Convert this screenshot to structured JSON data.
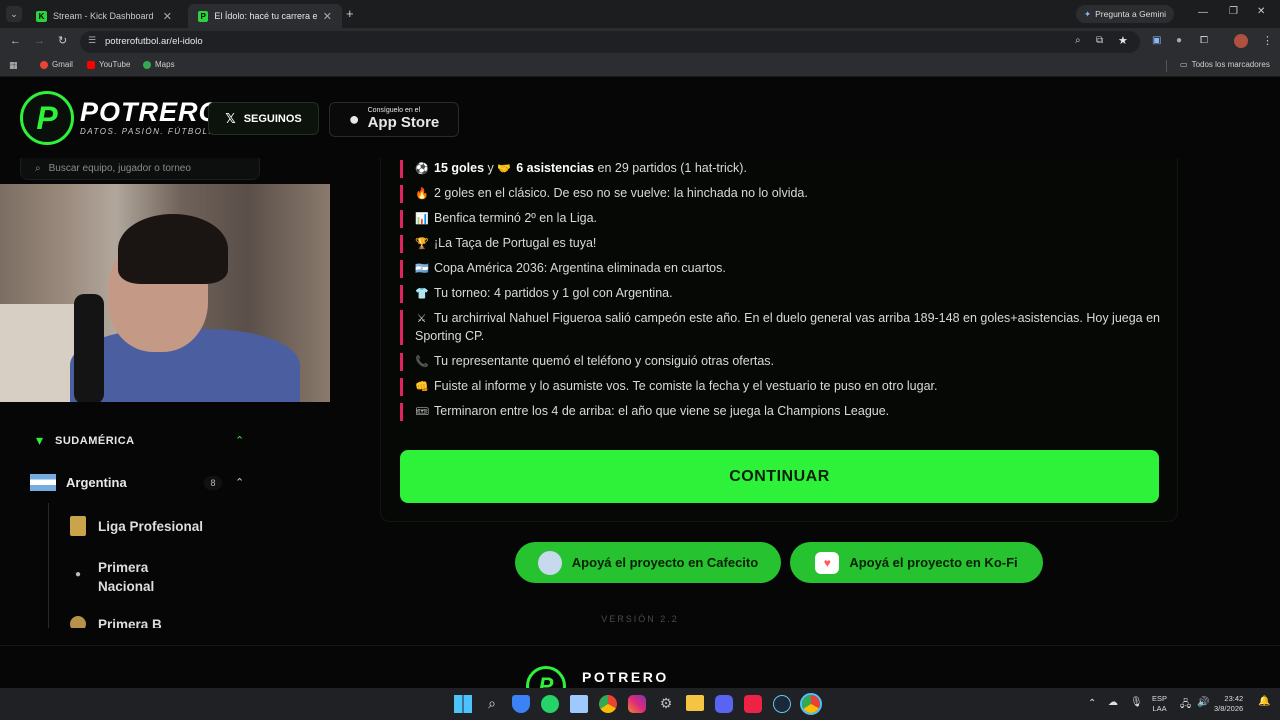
{
  "browser": {
    "tabs": [
      {
        "title": "Stream - Kick Dashboard",
        "active": false
      },
      {
        "title": "El Ídolo: hacé tu carrera en la Li",
        "active": true
      }
    ],
    "gemini_label": "Pregunta a Gemini",
    "url": "potrerofutbol.ar/el-idolo",
    "bookmarks": [
      "Gmail",
      "YouTube",
      "Maps"
    ],
    "all_bookmarks": "Todos los marcadores"
  },
  "header": {
    "logo_title": "POTRERO",
    "logo_tagline": "DATOS. PASIÓN. FÚTBOL.",
    "follow_label": "SEGUINOS",
    "appstore_small": "Consíguelo en el",
    "appstore_big": "App Store"
  },
  "sidebar": {
    "search_placeholder": "Buscar equipo, jugador o torneo",
    "region": "SUDAMÉRICA",
    "country": "Argentina",
    "country_count": "8",
    "leagues": [
      "Liga Profesional",
      "Primera Nacional",
      "Primera B"
    ]
  },
  "summary": {
    "lines": [
      {
        "icon": "soccer-ball-icon",
        "glyph": "⚽",
        "parts": [
          {
            "b": "15 goles"
          },
          {
            "t": " y "
          },
          {
            "i": "🤝"
          },
          {
            "b": "6 asistencias"
          },
          {
            "t": " en 29 partidos (1 hat-trick)."
          }
        ]
      },
      {
        "icon": "fire-icon",
        "glyph": "🔥",
        "text": "2 goles en el clásico. De eso no se vuelve: la hinchada no lo olvida."
      },
      {
        "icon": "chart-icon",
        "glyph": "📊",
        "text": "Benfica terminó 2º en la Liga."
      },
      {
        "icon": "trophy-icon",
        "glyph": "🏆",
        "text": "¡La Taça de Portugal es tuya!"
      },
      {
        "icon": "argentina-flag-icon",
        "glyph": "🇦🇷",
        "text": "Copa América 2036: Argentina eliminada en cuartos."
      },
      {
        "icon": "shirt-icon",
        "glyph": "👕",
        "text": "Tu torneo: 4 partidos y 1 gol con Argentina."
      },
      {
        "icon": "swords-icon",
        "glyph": "⚔",
        "text": "Tu archirrival Nahuel Figueroa salió campeón este año. En el duelo general vas arriba 189-148 en goles+asistencias. Hoy juega en Sporting CP."
      },
      {
        "icon": "phone-icon",
        "glyph": "📞",
        "text": "Tu representante quemó el teléfono y consiguió otras ofertas."
      },
      {
        "icon": "fist-icon",
        "glyph": "👊",
        "text": "Fuiste al informe y lo asumiste vos. Te comiste la fecha y el vestuario te puso en otro lugar."
      },
      {
        "icon": "ticket-icon",
        "glyph": "🎟",
        "text": "Terminaron entre los 4 de arriba: el año que viene se juega la Champions League."
      }
    ],
    "continue_label": "CONTINUAR"
  },
  "support": {
    "cafecito": "Apoyá el proyecto en Cafecito",
    "kofi": "Apoyá el proyecto en Ko-Fi"
  },
  "version": "VERSIÓN 2.2",
  "footer_brand": "POTRERO",
  "taskbar": {
    "lang": "ESP",
    "lang2": "LAA",
    "time": "23:42",
    "date": "3/8/2026"
  },
  "colors": {
    "accent": "#2ef23a",
    "bar": "#e0245e",
    "bg": "#050605"
  }
}
